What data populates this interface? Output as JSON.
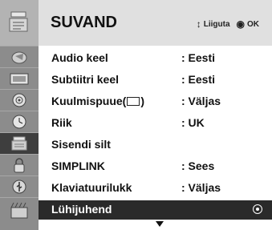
{
  "menu": {
    "title": "SUVAND",
    "hint_move_symbol": "↕",
    "hint_move_label": "Liiguta",
    "hint_ok_symbol": "◉",
    "hint_ok_label": "OK"
  },
  "sidebar": {
    "icons": [
      "setup-icon",
      "picture-icon",
      "audio-icon",
      "time-icon",
      "option-icon",
      "lock-icon",
      "usb-icon",
      "media-icon"
    ],
    "active_index": 4
  },
  "rows": [
    {
      "label": "Audio keel",
      "value": ": Eesti"
    },
    {
      "label": "Subtiitri keel",
      "value": ": Eesti"
    },
    {
      "label": "Kuulmispuue(",
      "value": ": Väljas"
    },
    {
      "label": "Riik",
      "value": ": UK"
    },
    {
      "label": "Sisendi silt",
      "value": ""
    },
    {
      "label": "SIMPLINK",
      "value": ": Sees"
    },
    {
      "label": "Klaviatuurilukk",
      "value": ": Väljas"
    }
  ],
  "cc_suffix": ")",
  "selected": {
    "label": "Lühijuhend"
  },
  "colors": {
    "sidebar": "#8c8c8c",
    "header": "#e0e0e0",
    "selected_row": "#2a2a2a",
    "active_tab": "#3e3e3e"
  }
}
